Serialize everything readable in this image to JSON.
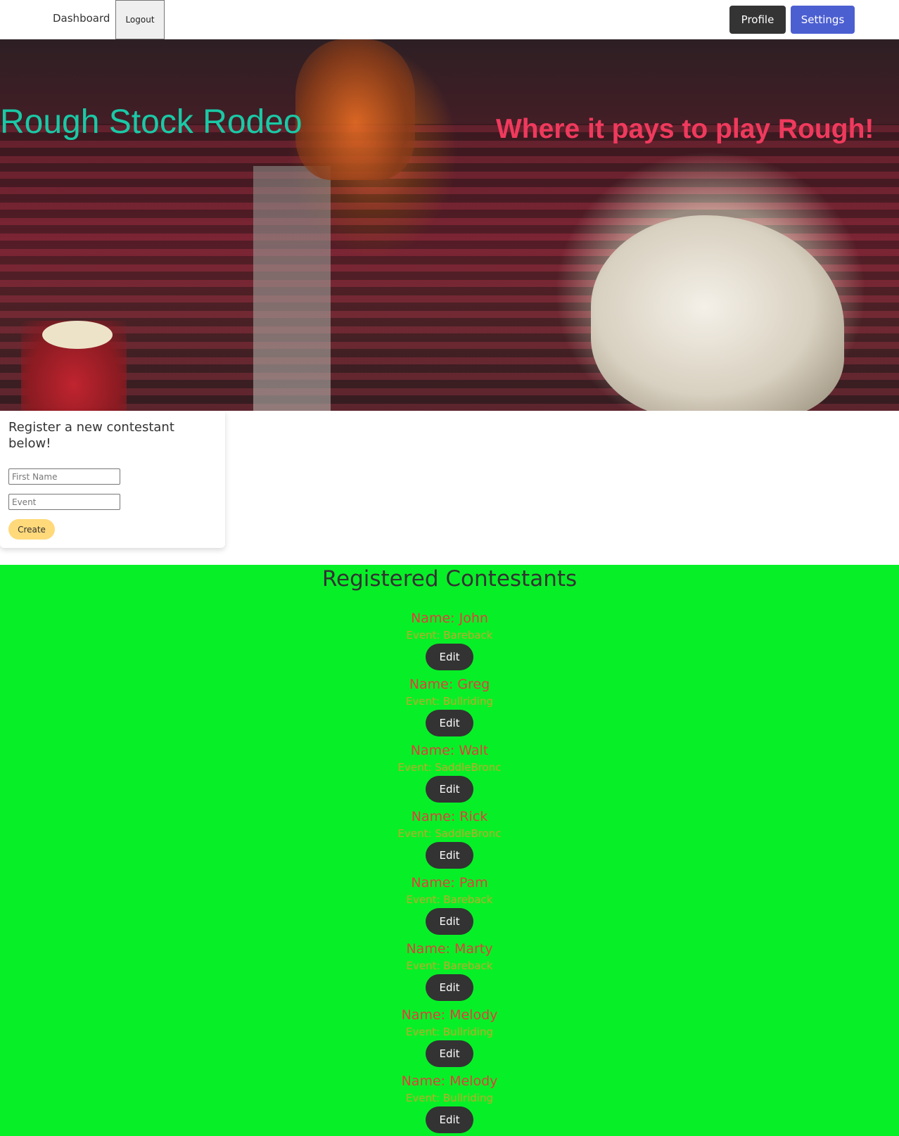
{
  "nav": {
    "dashboard": "Dashboard",
    "logout": "Logout",
    "profile": "Profile",
    "settings": "Settings"
  },
  "hero": {
    "title": "Rough Stock Rodeo",
    "tagline": "Where it pays to play Rough!"
  },
  "form": {
    "heading": "Register a new contestant below!",
    "first_name_placeholder": "First Name",
    "event_placeholder": "Event",
    "create_label": "Create"
  },
  "contestants": {
    "title": "Registered Contestants",
    "edit_label": "Edit",
    "items": [
      {
        "name": "Name: John",
        "event": "Event: Bareback"
      },
      {
        "name": "Name: Greg",
        "event": "Event: Bullriding"
      },
      {
        "name": "Name: Walt",
        "event": "Event: SaddleBronc"
      },
      {
        "name": "Name: Rick",
        "event": "Event: SaddleBronc"
      },
      {
        "name": "Name: Pam",
        "event": "Event: Bareback"
      },
      {
        "name": "Name: Marty",
        "event": "Event: Bareback"
      },
      {
        "name": "Name: Melody",
        "event": "Event: Bullriding"
      },
      {
        "name": "Name: Melody",
        "event": "Event: Bullriding"
      }
    ]
  }
}
